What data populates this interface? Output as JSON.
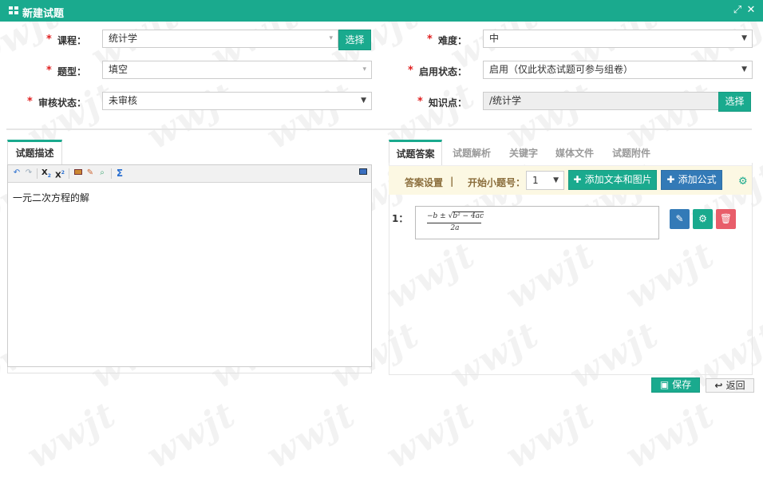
{
  "titlebar": {
    "title": "新建试题",
    "icons": [
      "grid-icon",
      "maximize-icon",
      "close-icon"
    ],
    "maximize_glyph": "⤢",
    "close_glyph": "✕"
  },
  "form": {
    "required_mark": "*",
    "course": {
      "label": "课程：",
      "value": "统计学",
      "select_button": "选择"
    },
    "difficulty": {
      "label": "难度：",
      "value": "中"
    },
    "type": {
      "label": "题型：",
      "value": "填空"
    },
    "enable_status": {
      "label": "启用状态：",
      "value": "启用（仅此状态试题可参与组卷）"
    },
    "review_status": {
      "label": "审核状态：",
      "value": "未审核"
    },
    "knowledge": {
      "label": "知识点：",
      "value": "/统计学",
      "select_button": "选择"
    }
  },
  "left_panel": {
    "tab_label": "试题描述",
    "editor_text": "一元二次方程的解",
    "toolbar_icons": [
      "undo-icon",
      "redo-icon",
      "subscript-icon",
      "superscript-icon",
      "image-icon",
      "eraser-icon",
      "zoom-icon",
      "sigma-icon",
      "fullscreen-icon"
    ]
  },
  "right_panel": {
    "tabs": [
      {
        "label": "试题答案",
        "active": true
      },
      {
        "label": "试题解析",
        "active": false
      },
      {
        "label": "关键字",
        "active": false
      },
      {
        "label": "媒体文件",
        "active": false
      },
      {
        "label": "试题附件",
        "active": false
      }
    ],
    "answer_bar": {
      "settings_label": "答案设置",
      "separator": "|",
      "start_label": "开始小题号：",
      "start_value": "1",
      "add_text_button": "添加文本和图片",
      "add_formula_button": "添加公式",
      "gear_icon": "gear-icon"
    },
    "answers": [
      {
        "index": "1：",
        "formula": {
          "numerator_prefix": "−b ± ",
          "radicand": "b² − 4ac",
          "denominator": "2a"
        },
        "actions": [
          "pencil-icon",
          "gear-icon",
          "trash-icon"
        ]
      }
    ]
  },
  "footer": {
    "save_button": "保存",
    "back_button": "返回"
  },
  "watermark": "wwjt",
  "colors": {
    "primary": "#1aaa8e",
    "blue": "#337ab7",
    "danger": "#e85d6a",
    "required": "#e02020",
    "answer_bar_bg": "#fcf8e3"
  }
}
